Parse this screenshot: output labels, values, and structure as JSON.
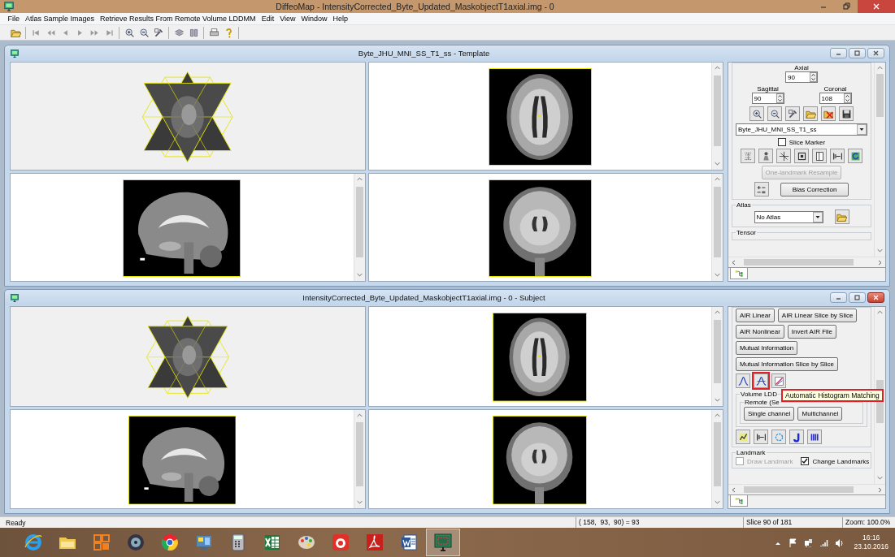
{
  "window": {
    "title": "DiffeoMap - IntensityCorrected_Byte_Updated_MaskobjectT1axial.img - 0"
  },
  "menu": [
    "File",
    "Atlas Sample Images",
    "Retrieve Results From Remote Volume LDDMM",
    "Edit",
    "View",
    "Window",
    "Help"
  ],
  "children": [
    {
      "title": "Byte_JHU_MNI_SS_T1_ss - Template",
      "active": false,
      "views": [
        {
          "kind": "render"
        },
        {
          "kind": "axial"
        },
        {
          "kind": "sagittal"
        },
        {
          "kind": "coronal"
        }
      ],
      "panel": {
        "rows": [
          {
            "kind": "group",
            "rows": [
              {
                "kind": "spinners",
                "items": [
                  {
                    "label": "Axial",
                    "value": "90"
                  }
                ]
              },
              {
                "kind": "spinners",
                "items": [
                  {
                    "label": "Sagittal",
                    "value": "90"
                  },
                  {
                    "label": "Coronal",
                    "value": "108"
                  }
                ]
              },
              {
                "kind": "icon-row"
              },
              {
                "kind": "dropdown",
                "value": "Byte_JHU_MNI_SS_T1_ss"
              },
              {
                "kind": "checkboxes",
                "items": [
                  {
                    "label": "Slice Marker",
                    "checked": false,
                    "disabled": false
                  }
                ]
              },
              {
                "kind": "icon-row"
              },
              {
                "kind": "buttons",
                "items": [
                  {
                    "label": "One-landmark Resample",
                    "disabled": true
                  }
                ]
              },
              {
                "kind": "tool-button",
                "label": "Bias Correction"
              }
            ]
          },
          {
            "kind": "group",
            "label": "Atlas",
            "rows": [
              {
                "kind": "dropdown-folder",
                "value": "No Atlas"
              }
            ]
          },
          {
            "kind": "group",
            "label": "Tensor"
          }
        ]
      }
    },
    {
      "title": "IntensityCorrected_Byte_Updated_MaskobjectT1axial.img - 0 - Subject",
      "active": true,
      "views": [
        {
          "kind": "render"
        },
        {
          "kind": "axial"
        },
        {
          "kind": "sagittal"
        },
        {
          "kind": "coronal"
        }
      ],
      "panel": {
        "kind": "registration",
        "rows": [
          {
            "kind": "group",
            "rows": [
              {
                "kind": "buttons",
                "items": [
                  {
                    "label": "AIR Linear",
                    "disabled": false
                  },
                  {
                    "label": "AIR Linear Slice by Slice",
                    "disabled": false
                  }
                ]
              },
              {
                "kind": "buttons",
                "items": [
                  {
                    "label": "AIR Nonlinear",
                    "disabled": false
                  },
                  {
                    "label": "Invert AIR File",
                    "disabled": false
                  }
                ]
              },
              {
                "kind": "buttons",
                "items": [
                  {
                    "label": "Mutual Information",
                    "disabled": false
                  }
                ]
              },
              {
                "kind": "buttons",
                "items": [
                  {
                    "label": "Mutual Information Slice by Slice",
                    "disabled": false
                  }
                ]
              },
              {
                "kind": "icon-row",
                "items": [
                  {
                    "highlighted": false
                  },
                  {
                    "highlighted": true,
                    "tooltip": "Automatic Histogram Matching"
                  },
                  {
                    "highlighted": false
                  }
                ]
              },
              {
                "kind": "group",
                "label": "Volume LDD",
                "rows": [
                  {
                    "kind": "group",
                    "label": "Remote (Se",
                    "rows": [
                      {
                        "kind": "buttons",
                        "items": [
                          {
                            "label": "Single channel",
                            "disabled": false
                          },
                          {
                            "label": "Multichannel",
                            "disabled": false
                          }
                        ]
                      }
                    ]
                  }
                ]
              },
              {
                "kind": "icon-row"
              }
            ]
          },
          {
            "kind": "group",
            "label": "Landmark",
            "rows": [
              {
                "kind": "checkboxes",
                "items": [
                  {
                    "label": "Draw Landmark",
                    "checked": false,
                    "disabled": true
                  },
                  {
                    "label": "Change Landmarks",
                    "checked": true,
                    "disabled": false
                  }
                ]
              }
            ]
          }
        ]
      }
    }
  ],
  "status_bar": {
    "message": "Ready",
    "cells": [
      "( 158,  93,  90) = 93",
      "Slice 90 of 181",
      "Zoom: 100.0%"
    ]
  },
  "taskbar": {
    "apps": [
      {
        "selected": false
      },
      {
        "selected": false
      },
      {
        "selected": false
      },
      {
        "selected": false
      },
      {
        "selected": false
      },
      {
        "selected": false
      },
      {
        "selected": false
      },
      {
        "selected": false
      },
      {
        "selected": false
      },
      {
        "selected": false
      },
      {
        "selected": false
      },
      {
        "selected": false
      },
      {
        "selected": true
      }
    ],
    "time": "16:16",
    "date": "23.10.2016"
  }
}
